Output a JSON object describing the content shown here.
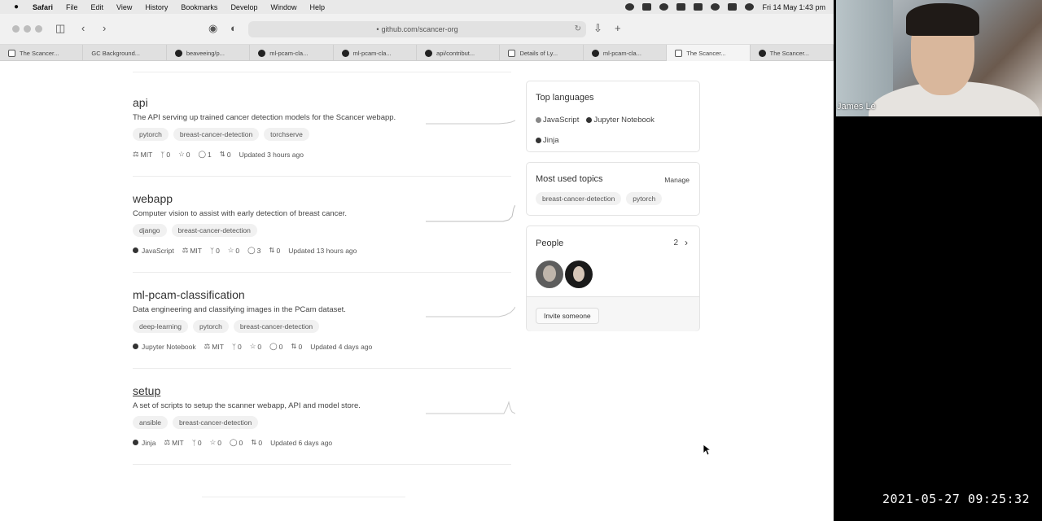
{
  "menubar": {
    "app": "Safari",
    "items": [
      "File",
      "Edit",
      "View",
      "History",
      "Bookmarks",
      "Develop",
      "Window",
      "Help"
    ],
    "clock": "Fri 14 May  1:43 pm"
  },
  "browser": {
    "url": "github.com/scancer-org",
    "tabs": [
      {
        "label": "The Scancer..."
      },
      {
        "label": "GC Background..."
      },
      {
        "label": "beaveeing/p..."
      },
      {
        "label": "ml-pcam-cla..."
      },
      {
        "label": "ml-pcam-cla..."
      },
      {
        "label": "api/contribut..."
      },
      {
        "label": "Details of Ly..."
      },
      {
        "label": "ml-pcam-cla..."
      },
      {
        "label": "The Scancer..."
      },
      {
        "label": "The Scancer..."
      }
    ]
  },
  "repos": [
    {
      "name": "api",
      "description": "The API serving up trained cancer detection models for the Scancer webapp.",
      "topics": [
        "pytorch",
        "breast-cancer-detection",
        "torchserve"
      ],
      "language": "",
      "license": "MIT",
      "forks": "0",
      "stars": "0",
      "issues": "1",
      "prs": "0",
      "updated": "Updated 3 hours ago"
    },
    {
      "name": "webapp",
      "description": "Computer vision to assist with early detection of breast cancer.",
      "topics": [
        "django",
        "breast-cancer-detection"
      ],
      "language": "JavaScript",
      "license": "MIT",
      "forks": "0",
      "stars": "0",
      "issues": "3",
      "prs": "0",
      "updated": "Updated 13 hours ago"
    },
    {
      "name": "ml-pcam-classification",
      "description": "Data engineering and classifying images in the PCam dataset.",
      "topics": [
        "deep-learning",
        "pytorch",
        "breast-cancer-detection"
      ],
      "language": "Jupyter Notebook",
      "license": "MIT",
      "forks": "0",
      "stars": "0",
      "issues": "0",
      "prs": "0",
      "updated": "Updated 4 days ago"
    },
    {
      "name": "setup",
      "description": "A set of scripts to setup the scanner webapp, API and model store.",
      "topics": [
        "ansible",
        "breast-cancer-detection"
      ],
      "language": "Jinja",
      "license": "MIT",
      "forks": "0",
      "stars": "0",
      "issues": "0",
      "prs": "0",
      "updated": "Updated 6 days ago"
    }
  ],
  "sidebar": {
    "top_languages": {
      "title": "Top languages",
      "items": [
        "JavaScript",
        "Jupyter Notebook",
        "Jinja"
      ]
    },
    "topics": {
      "title": "Most used topics",
      "manage": "Manage",
      "items": [
        "breast-cancer-detection",
        "pytorch"
      ]
    },
    "people": {
      "title": "People",
      "count": "2",
      "invite": "Invite someone"
    }
  },
  "video": {
    "name": "James Le",
    "timestamp": "2021-05-27  09:25:32"
  }
}
